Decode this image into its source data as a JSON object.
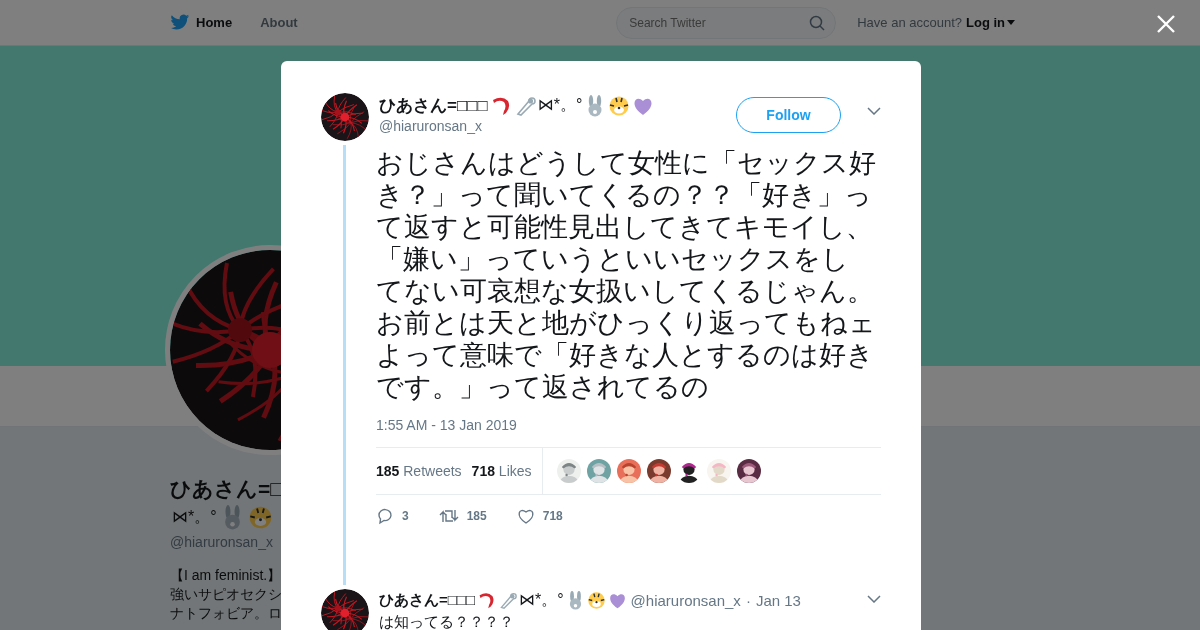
{
  "nav": {
    "items": [
      {
        "label": "Home"
      },
      {
        "label": "About"
      }
    ],
    "search": {
      "placeholder": "Search Twitter"
    },
    "account_prompt": "Have an account?",
    "login": "Log in"
  },
  "profile": {
    "name": "ひあさん=□",
    "name_suffix": "⋈*。°",
    "handle": "@hiaruronsan_x",
    "bio": [
      "【I am feminist.】",
      "強いサピオセクシ",
      "ナトフォビア。ロ"
    ]
  },
  "tweet": {
    "name": "ひあさん=□□□",
    "name_suffix": "⋈*。°",
    "handle": "@hiaruronsan_x",
    "follow": "Follow",
    "paragraphs": [
      "おじさんはどうして女性に「セックス好き？」って聞いてくるの？？「好き」って返すと可能性見出してきてキモイし、「嫌い」っていうといいセックスをしてない可哀想な女扱いしてくるじゃん。",
      "お前とは天と地がひっくり返ってもねェよって意味で「好きな人とするのは好きです。」って返されてるの"
    ],
    "time": "1:55 AM - 13 Jan 2019",
    "retweets": {
      "count": "185",
      "label": "Retweets"
    },
    "likes": {
      "count": "718",
      "label": "Likes"
    },
    "likers": [
      {
        "kind": "picture"
      },
      {
        "kind": "picture"
      },
      {
        "kind": "picture"
      },
      {
        "kind": "picture"
      },
      {
        "kind": "picture"
      },
      {
        "kind": "picture"
      },
      {
        "kind": "picture"
      }
    ],
    "actions": [
      {
        "kind": "reply",
        "count": "3"
      },
      {
        "kind": "retweet",
        "count": "185"
      },
      {
        "kind": "like",
        "count": "718"
      }
    ]
  },
  "reply": {
    "name": "ひあさん=□□□",
    "name_suffix": "⋈*。°",
    "handle": "@hiaruronsan_x",
    "separator": "·",
    "date": "Jan 13",
    "text": "は知ってる？？？？"
  }
}
